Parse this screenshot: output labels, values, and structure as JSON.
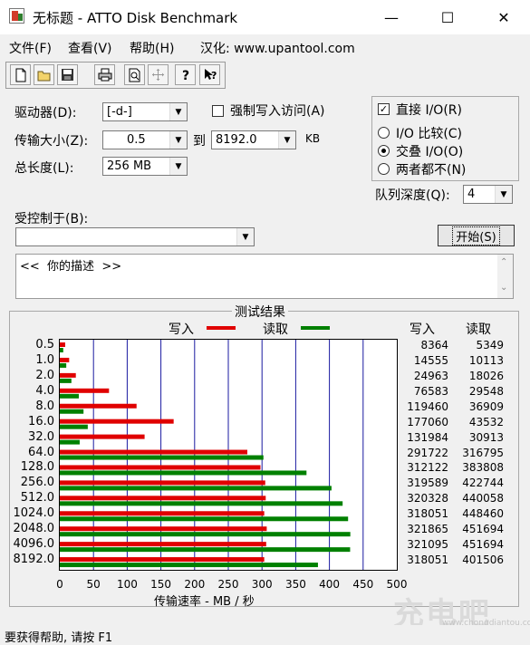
{
  "window": {
    "title": "无标题 - ATTO Disk Benchmark",
    "minimize": "—",
    "maximize": "☐",
    "close": "✕"
  },
  "menu": {
    "file": "文件(F)",
    "view": "查看(V)",
    "help": "帮助(H)",
    "sinicize": "汉化: www.upantool.com"
  },
  "toolbar": {
    "icons": [
      "new-icon",
      "open-icon",
      "save-icon",
      "print-icon",
      "print-preview-icon",
      "move-icon",
      "help-icon",
      "context-help-icon"
    ]
  },
  "settings": {
    "drive_label": "驱动器(D):",
    "drive_value": "[-d-]",
    "force_write_label": "强制写入访问(A)",
    "transfer_label": "传输大小(Z):",
    "transfer_min": "0.5",
    "to_label": "到",
    "transfer_max": "8192.0",
    "unit": "KB",
    "length_label": "总长度(L):",
    "length_value": "256 MB",
    "direct_io_label": "直接 I/O(R)",
    "direct_io_checked": true,
    "io_compare_label": "I/O 比较(C)",
    "overlapped_label": "交叠 I/O(O)",
    "neither_label": "两者都不(N)",
    "queue_label": "队列深度(Q):",
    "queue_value": "4",
    "controlled_by_label": "受控制于(B):",
    "controlled_by_value": "",
    "start_label": "开始(S)",
    "description": "<<  你的描述  >>"
  },
  "results": {
    "title": "测试结果",
    "write_legend": "写入",
    "read_legend": "读取",
    "write_header": "写入",
    "read_header": "读取",
    "xlabel": "传输速率 - MB / 秒",
    "write_color": "#e00000",
    "read_color": "#008000"
  },
  "chart_data": {
    "type": "bar",
    "orientation": "horizontal",
    "title": "测试结果",
    "xlabel": "传输速率 - MB / 秒",
    "xlim": [
      0,
      500
    ],
    "xticks": [
      0,
      50,
      100,
      150,
      200,
      250,
      300,
      350,
      400,
      450,
      500
    ],
    "categories": [
      "0.5",
      "1.0",
      "2.0",
      "4.0",
      "8.0",
      "16.0",
      "32.0",
      "64.0",
      "128.0",
      "256.0",
      "512.0",
      "1024.0",
      "2048.0",
      "4096.0",
      "8192.0"
    ],
    "series": [
      {
        "name": "写入",
        "values": [
          8.0,
          13.9,
          23.8,
          73.0,
          113.9,
          168.9,
          125.8,
          278.2,
          297.7,
          304.8,
          305.5,
          303.3,
          307.0,
          306.2,
          303.3
        ]
      },
      {
        "name": "读取",
        "values": [
          5.1,
          9.6,
          17.2,
          28.2,
          35.2,
          41.5,
          29.5,
          302.1,
          366.0,
          403.1,
          419.6,
          427.7,
          431.0,
          430.7,
          383.0
        ]
      }
    ],
    "write_values": [
      "8364",
      "14555",
      "24963",
      "76583",
      "119460",
      "177060",
      "131984",
      "291722",
      "312122",
      "319589",
      "320328",
      "318051",
      "321865",
      "321095",
      "318051"
    ],
    "read_values": [
      "5349",
      "10113",
      "18026",
      "29548",
      "36909",
      "43532",
      "30913",
      "316795",
      "383808",
      "422744",
      "440058",
      "448460",
      "451694",
      "451694",
      "401506"
    ],
    "grid": true
  },
  "status": {
    "text": "要获得帮助, 请按 F1"
  },
  "watermark": {
    "text": "充电吧",
    "url": "www.chongdiantou.com"
  }
}
